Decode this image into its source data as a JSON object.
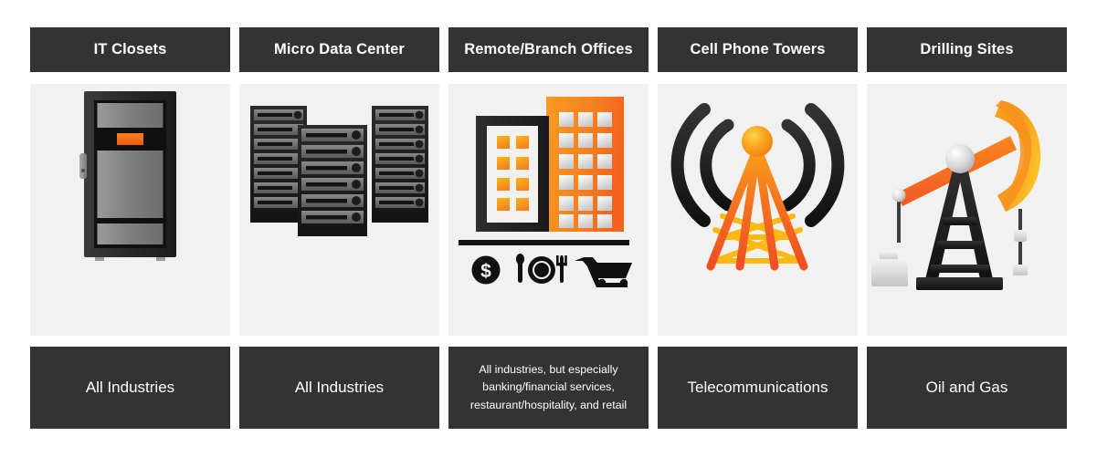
{
  "theme": {
    "header_bg": "#333333",
    "panel_bg": "#f1f1f1",
    "page_bg": "#ffffff",
    "text_light": "#ffffff",
    "accent_orange": "#f26522",
    "accent_orange_light": "#f7941e",
    "accent_yellow": "#fdb913",
    "dark_icon": "#231f20",
    "gray_metal": "#8d8d8d"
  },
  "columns": [
    {
      "header": "IT Closets",
      "icon": "server-rack-cabinet-icon",
      "footer": "All Industries",
      "footer_multiline": false
    },
    {
      "header": "Micro Data Center",
      "icon": "server-racks-icon",
      "footer": "All Industries",
      "footer_multiline": false
    },
    {
      "header": "Remote/Branch Offices",
      "icon": "office-buildings-icon",
      "footer_lines": [
        "All industries, but especially",
        "banking/financial services,",
        "restaurant/hospitality, and retail"
      ],
      "footer_multiline": true,
      "sub_icons": [
        "dollar-coin-icon",
        "plate-utensils-icon",
        "shopping-cart-icon"
      ]
    },
    {
      "header": "Cell Phone Towers",
      "icon": "cell-tower-icon",
      "footer": "Telecommunications",
      "footer_multiline": false
    },
    {
      "header": "Drilling Sites",
      "icon": "oil-pumpjack-icon",
      "footer": "Oil and Gas",
      "footer_multiline": false
    }
  ]
}
